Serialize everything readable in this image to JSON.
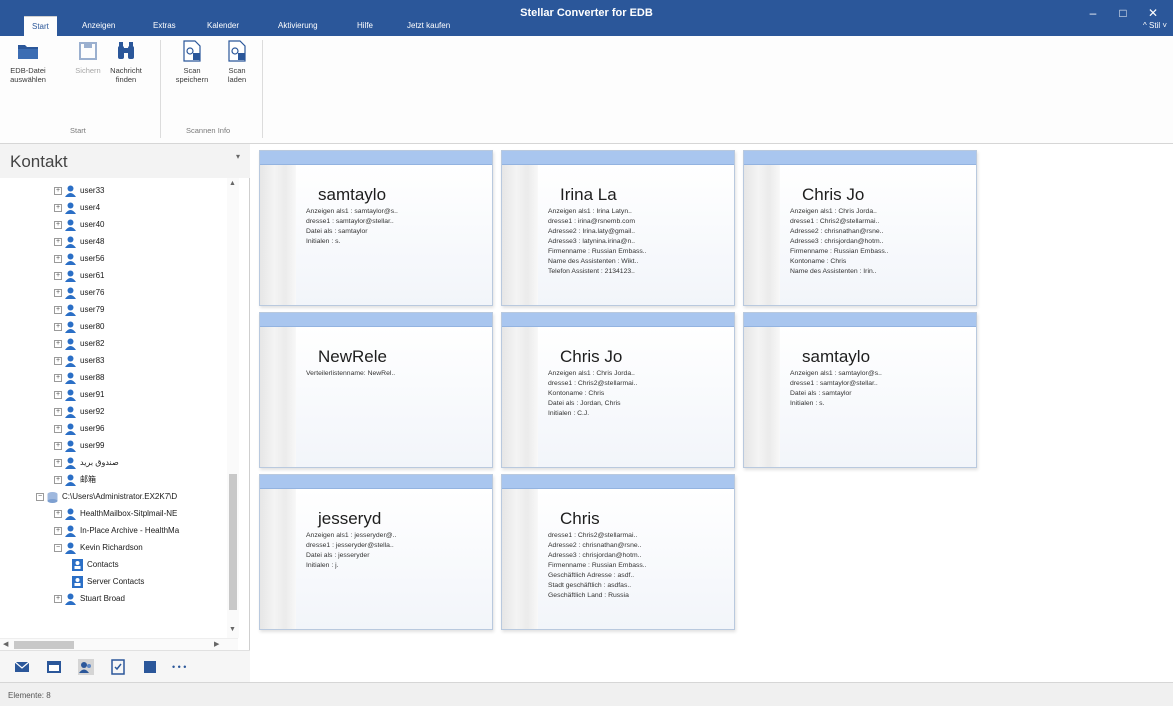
{
  "window": {
    "title": "Stellar Converter for EDB",
    "minimize_glyph": "–",
    "maximize_glyph": "□",
    "close_glyph": "✕"
  },
  "tabs": [
    {
      "label": "Start",
      "active": true
    },
    {
      "label": "Anzeigen",
      "active": false
    },
    {
      "label": "Extras",
      "active": false
    },
    {
      "label": "Kalender",
      "active": false
    },
    {
      "label": "Aktivierung",
      "active": false
    },
    {
      "label": "Hilfe",
      "active": false
    },
    {
      "label": "Jetzt kaufen",
      "active": false
    }
  ],
  "stil_label": "^ Stil ˅",
  "ribbon": {
    "buttons": [
      {
        "label_line1": "EDB-Datei",
        "label_line2": "auswählen",
        "icon": "folder-icon",
        "disabled": false
      },
      {
        "label_line1": "Sichern",
        "label_line2": "",
        "icon": "save-icon",
        "disabled": true
      },
      {
        "label_line1": "Nachricht",
        "label_line2": "finden",
        "icon": "binoculars-icon",
        "disabled": false
      },
      {
        "label_line1": "Scan",
        "label_line2": "speichern",
        "icon": "scan-save-icon",
        "disabled": false
      },
      {
        "label_line1": "Scan",
        "label_line2": "laden",
        "icon": "scan-load-icon",
        "disabled": false
      }
    ],
    "groups": [
      {
        "label": "Start"
      },
      {
        "label": "Scannen Info"
      }
    ]
  },
  "left_pane": {
    "title": "Kontakt",
    "pin_glyph": "▾",
    "tree": [
      {
        "label": "user33",
        "level": 1,
        "kind": "user"
      },
      {
        "label": "user4",
        "level": 1,
        "kind": "user"
      },
      {
        "label": "user40",
        "level": 1,
        "kind": "user"
      },
      {
        "label": "user48",
        "level": 1,
        "kind": "user"
      },
      {
        "label": "user56",
        "level": 1,
        "kind": "user"
      },
      {
        "label": "user61",
        "level": 1,
        "kind": "user"
      },
      {
        "label": "user76",
        "level": 1,
        "kind": "user"
      },
      {
        "label": "user79",
        "level": 1,
        "kind": "user"
      },
      {
        "label": "user80",
        "level": 1,
        "kind": "user"
      },
      {
        "label": "user82",
        "level": 1,
        "kind": "user"
      },
      {
        "label": "user83",
        "level": 1,
        "kind": "user"
      },
      {
        "label": "user88",
        "level": 1,
        "kind": "user"
      },
      {
        "label": "user91",
        "level": 1,
        "kind": "user"
      },
      {
        "label": "user92",
        "level": 1,
        "kind": "user"
      },
      {
        "label": "user96",
        "level": 1,
        "kind": "user"
      },
      {
        "label": "user99",
        "level": 1,
        "kind": "user"
      },
      {
        "label": "صندوق بريد",
        "level": 1,
        "kind": "user"
      },
      {
        "label": "邮箱",
        "level": 1,
        "kind": "user"
      },
      {
        "label": "C:\\Users\\Administrator.EX2K7\\D",
        "level": 0,
        "kind": "db"
      },
      {
        "label": "HealthMailbox-Sitplmail-NE",
        "level": 1,
        "kind": "user"
      },
      {
        "label": "In-Place Archive - HealthMa",
        "level": 1,
        "kind": "user"
      },
      {
        "label": "Kevin Richardson",
        "level": 1,
        "kind": "user",
        "expanded": true
      },
      {
        "label": "Contacts",
        "level": 2,
        "kind": "folder"
      },
      {
        "label": "Server Contacts",
        "level": 2,
        "kind": "folder"
      },
      {
        "label": "Stuart Broad",
        "level": 1,
        "kind": "user"
      }
    ],
    "nav_icons": [
      {
        "icon": "mail-icon"
      },
      {
        "icon": "calendar-icon"
      },
      {
        "icon": "contacts-icon",
        "selected": true
      },
      {
        "icon": "tasks-icon"
      },
      {
        "icon": "notes-icon"
      },
      {
        "icon": "more-icon",
        "text": "• • •"
      }
    ]
  },
  "cards": [
    {
      "name": "samtaylo",
      "lines": [
        "Anzeigen als1 : samtaylor@s..",
        "dresse1 : samtaylor@stellar..",
        "Datei als : samtaylor",
        "Initialen : s."
      ]
    },
    {
      "name": "Irina La",
      "lines": [
        "Anzeigen als1 : Irina Latyn..",
        "dresse1 : irina@rsnemb.com",
        "Adresse2 : Irina.laty@gmail..",
        "Adresse3 : latynina.irina@n..",
        "Firmenname : Russian Embass..",
        "Name des Assistenten : Wikt..",
        "Telefon Assistent : 2134123.."
      ]
    },
    {
      "name": "Chris Jo",
      "lines": [
        "Anzeigen als1 : Chris Jorda..",
        "dresse1 : Chris2@stellarmai..",
        "Adresse2 : chrisnathan@rsne..",
        "Adresse3 : chrisjordan@hotm..",
        "Firmenname : Russian Embass..",
        "Kontoname : Chris",
        "Name des Assistenten : Irin.."
      ]
    },
    {
      "name": "NewRele",
      "lines": [
        "Verteilerlistenname: NewRel.."
      ]
    },
    {
      "name": "Chris Jo",
      "lines": [
        "Anzeigen als1 : Chris Jorda..",
        "dresse1 : Chris2@stellarmai..",
        "Kontoname : Chris",
        "Datei als : Jordan, Chris",
        "Initialen : C.J."
      ]
    },
    {
      "name": "samtaylo",
      "lines": [
        "Anzeigen als1 : samtaylor@s..",
        "dresse1 : samtaylor@stellar..",
        "Datei als : samtaylor",
        "Initialen : s."
      ]
    },
    {
      "name": "jesseryd",
      "lines": [
        "Anzeigen als1 : jesseryder@..",
        "dresse1 : jesseryder@stella..",
        "Datei als : jesseryder",
        "Initialen : j."
      ]
    },
    {
      "name": "Chris",
      "lines": [
        "dresse1 : Chris2@stellarmai..",
        "Adresse2 : chrisnathan@rsne..",
        "Adresse3 : chrisjordan@hotm..",
        "Firmenname : Russian Embass..",
        "Geschäftlich Adresse : asdf..",
        "Stadt geschäftlich : asdfas..",
        "Geschäftlich Land : Russia"
      ]
    }
  ],
  "status": {
    "text": "Elemente: 8"
  },
  "colors": {
    "titlebar": "#2b579a",
    "card_header": "#a9c6ef",
    "accent": "#2b579a"
  }
}
